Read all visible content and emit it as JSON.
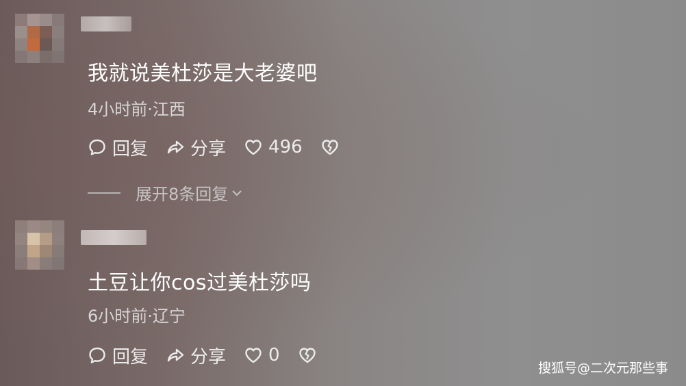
{
  "comments": [
    {
      "text": "我就说美杜莎是大老婆吧",
      "time_location": "4小时前·江西",
      "reply_label": "回复",
      "share_label": "分享",
      "like_count": "496",
      "expand_label": "展开8条回复"
    },
    {
      "text": "土豆让你cos过美杜莎吗",
      "time_location": "6小时前·辽宁",
      "reply_label": "回复",
      "share_label": "分享",
      "like_count": "0"
    }
  ],
  "watermark": "搜狐号@二次元那些事",
  "icons": {
    "reply": "comment-bubble-icon",
    "share": "share-arrow-icon",
    "like": "heart-icon",
    "dislike": "broken-heart-icon",
    "expand": "chevron-down-icon"
  }
}
